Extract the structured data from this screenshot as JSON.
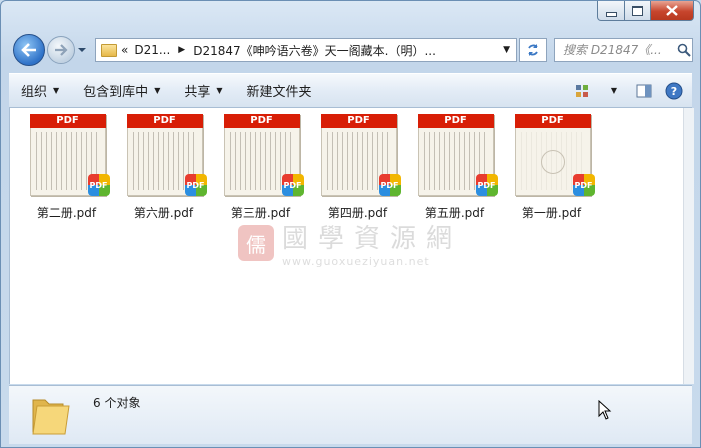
{
  "window": {
    "caption_buttons": {
      "minimize": "minimize",
      "maximize": "maximize",
      "close": "close"
    }
  },
  "address_bar": {
    "breadcrumb": [
      "D21...",
      "D21847《呻吟语六卷》天一阁藏本.（明）..."
    ],
    "overflow_marker": "«"
  },
  "search": {
    "placeholder": "搜索 D21847《...",
    "icon": "search-icon"
  },
  "toolbar": {
    "organize": "组织",
    "include_in_library": "包含到库中",
    "share": "共享",
    "new_folder": "新建文件夹"
  },
  "files": [
    {
      "name": "第二册.pdf",
      "banner": "PDF"
    },
    {
      "name": "第六册.pdf",
      "banner": "PDF"
    },
    {
      "name": "第三册.pdf",
      "banner": "PDF"
    },
    {
      "name": "第四册.pdf",
      "banner": "PDF"
    },
    {
      "name": "第五册.pdf",
      "banner": "PDF"
    },
    {
      "name": "第一册.pdf",
      "banner": "PDF"
    }
  ],
  "watermark": {
    "text": "國學資源網",
    "url": "www.guoxueziyuan.net",
    "logo": "儒"
  },
  "status": {
    "count_text": "6 个对象"
  },
  "colors": {
    "pdf_banner": "#d81e06",
    "window_chrome": "#c3d6ea",
    "close_button": "#c7452d"
  }
}
